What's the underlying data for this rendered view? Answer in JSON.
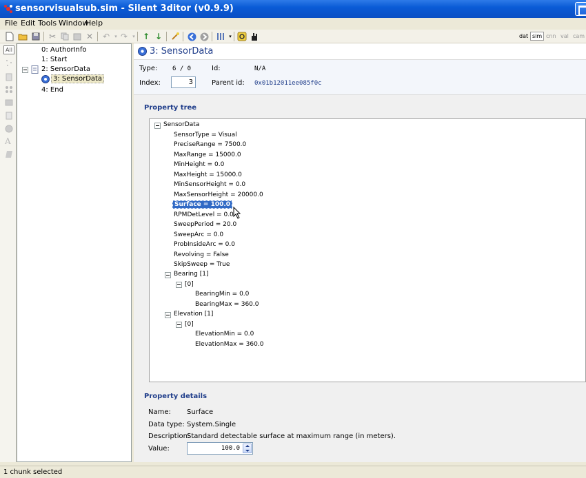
{
  "window": {
    "title": "sensorvisualsub.sim - Silent 3ditor (v0.9.9)"
  },
  "menu": [
    "File",
    "Edit",
    "Tools",
    "Window",
    "Help"
  ],
  "toolbar": {
    "modes": [
      "dat",
      "sim",
      "cnn",
      "val",
      "cam"
    ],
    "active_mode": "sim"
  },
  "leftstrip": {
    "all_label": "All"
  },
  "chunk_tree": [
    {
      "label": "0: AuthorInfo"
    },
    {
      "label": "1: Start"
    },
    {
      "label": "2: SensorData"
    },
    {
      "label": "3: SensorData",
      "selected": true
    },
    {
      "label": "4: End"
    }
  ],
  "chunk": {
    "title": "3: SensorData",
    "type_label": "Type:",
    "type_value": "6 / 0",
    "id_label": "Id:",
    "id_value": "N/A",
    "index_label": "Index:",
    "index_value": "3",
    "parent_label": "Parent id:",
    "parent_value": "0x01b12011ee085f0c"
  },
  "property_tree": {
    "title": "Property tree",
    "root": "SensorData",
    "props": [
      "SensorType = Visual",
      "PreciseRange = 7500.0",
      "MaxRange = 15000.0",
      "MinHeight = 0.0",
      "MaxHeight = 15000.0",
      "MinSensorHeight = 0.0",
      "MaxSensorHeight = 20000.0",
      "Surface = 100.0",
      "RPMDetLevel = 0.0",
      "SweepPeriod = 20.0",
      "SweepArc = 0.0",
      "ProbInsideArc = 0.0",
      "Revolving = False",
      "SkipSweep = True"
    ],
    "selected": "Surface = 100.0",
    "bearing": {
      "label": "Bearing [1]",
      "index": "[0]",
      "min": "BearingMin = 0.0",
      "max": "BearingMax = 360.0"
    },
    "elevation": {
      "label": "Elevation [1]",
      "index": "[0]",
      "min": "ElevationMin = 0.0",
      "max": "ElevationMax = 360.0"
    }
  },
  "property_details": {
    "title": "Property details",
    "name_label": "Name:",
    "name_value": "Surface",
    "type_label": "Data type:",
    "type_value": "System.Single",
    "desc_label": "Description:",
    "desc_value": "Standard detectable surface at maximum range (in meters).",
    "value_label": "Value:",
    "value": "100.0"
  },
  "status": {
    "text": "1 chunk selected"
  }
}
